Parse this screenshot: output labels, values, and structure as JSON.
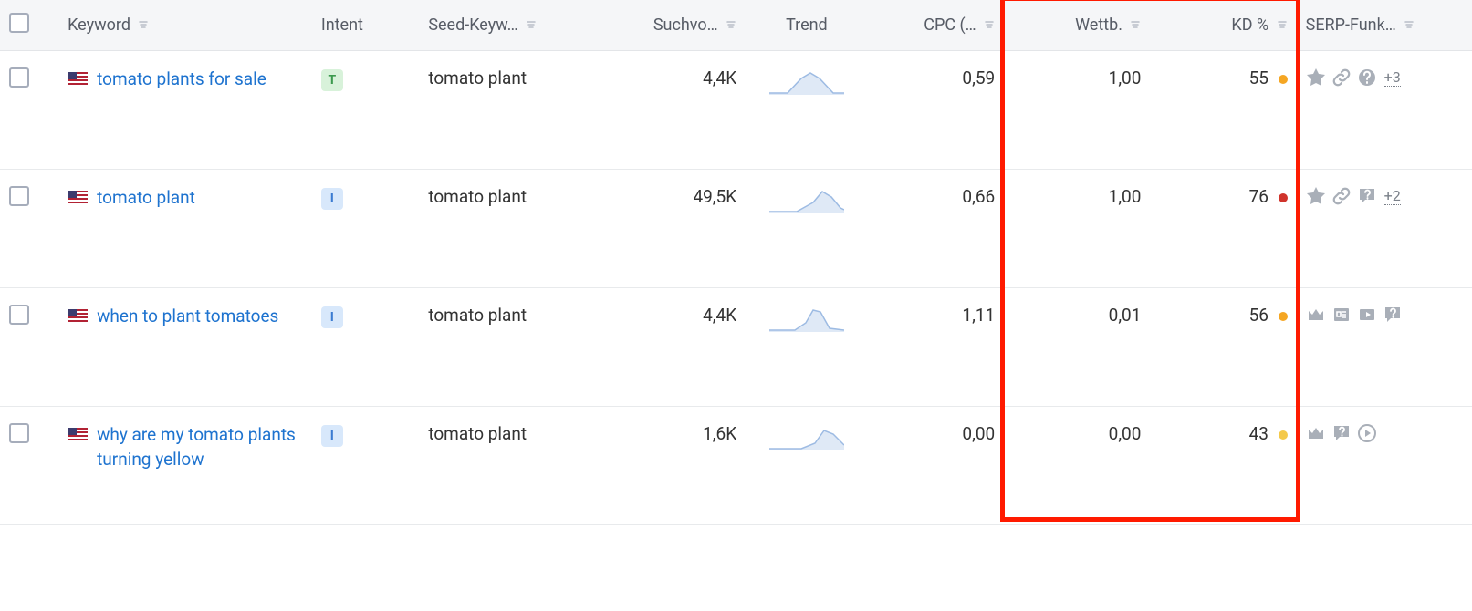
{
  "columns": {
    "keyword": "Keyword",
    "intent": "Intent",
    "seed": "Seed-Keyw…",
    "volume": "Suchvo…",
    "trend": "Trend",
    "cpc": "CPC (…",
    "wettb": "Wettb.",
    "kd": "KD %",
    "serp": "SERP-Funk…"
  },
  "rows": [
    {
      "keyword": "tomato plants for sale",
      "intent": "T",
      "seed": "tomato plant",
      "volume": "4,4K",
      "cpc": "0,59",
      "wettb": "1,00",
      "kd": "55",
      "kd_color": "orange",
      "serp_icons": [
        "star",
        "link",
        "question"
      ],
      "serp_more": "+3"
    },
    {
      "keyword": "tomato plant",
      "intent": "I",
      "seed": "tomato plant",
      "volume": "49,5K",
      "cpc": "0,66",
      "wettb": "1,00",
      "kd": "76",
      "kd_color": "red",
      "serp_icons": [
        "star",
        "link",
        "comment-q"
      ],
      "serp_more": "+2"
    },
    {
      "keyword": "when to plant tomatoes",
      "intent": "I",
      "seed": "tomato plant",
      "volume": "4,4K",
      "cpc": "1,11",
      "wettb": "0,01",
      "kd": "56",
      "kd_color": "orange",
      "serp_icons": [
        "crown",
        "news",
        "video",
        "comment-q"
      ],
      "serp_more": ""
    },
    {
      "keyword": "why are my tomato plants turning yellow",
      "intent": "I",
      "seed": "tomato plant",
      "volume": "1,6K",
      "cpc": "0,00",
      "wettb": "0,00",
      "kd": "43",
      "kd_color": "yellow",
      "serp_icons": [
        "crown",
        "comment-q",
        "play"
      ],
      "serp_more": ""
    }
  ]
}
